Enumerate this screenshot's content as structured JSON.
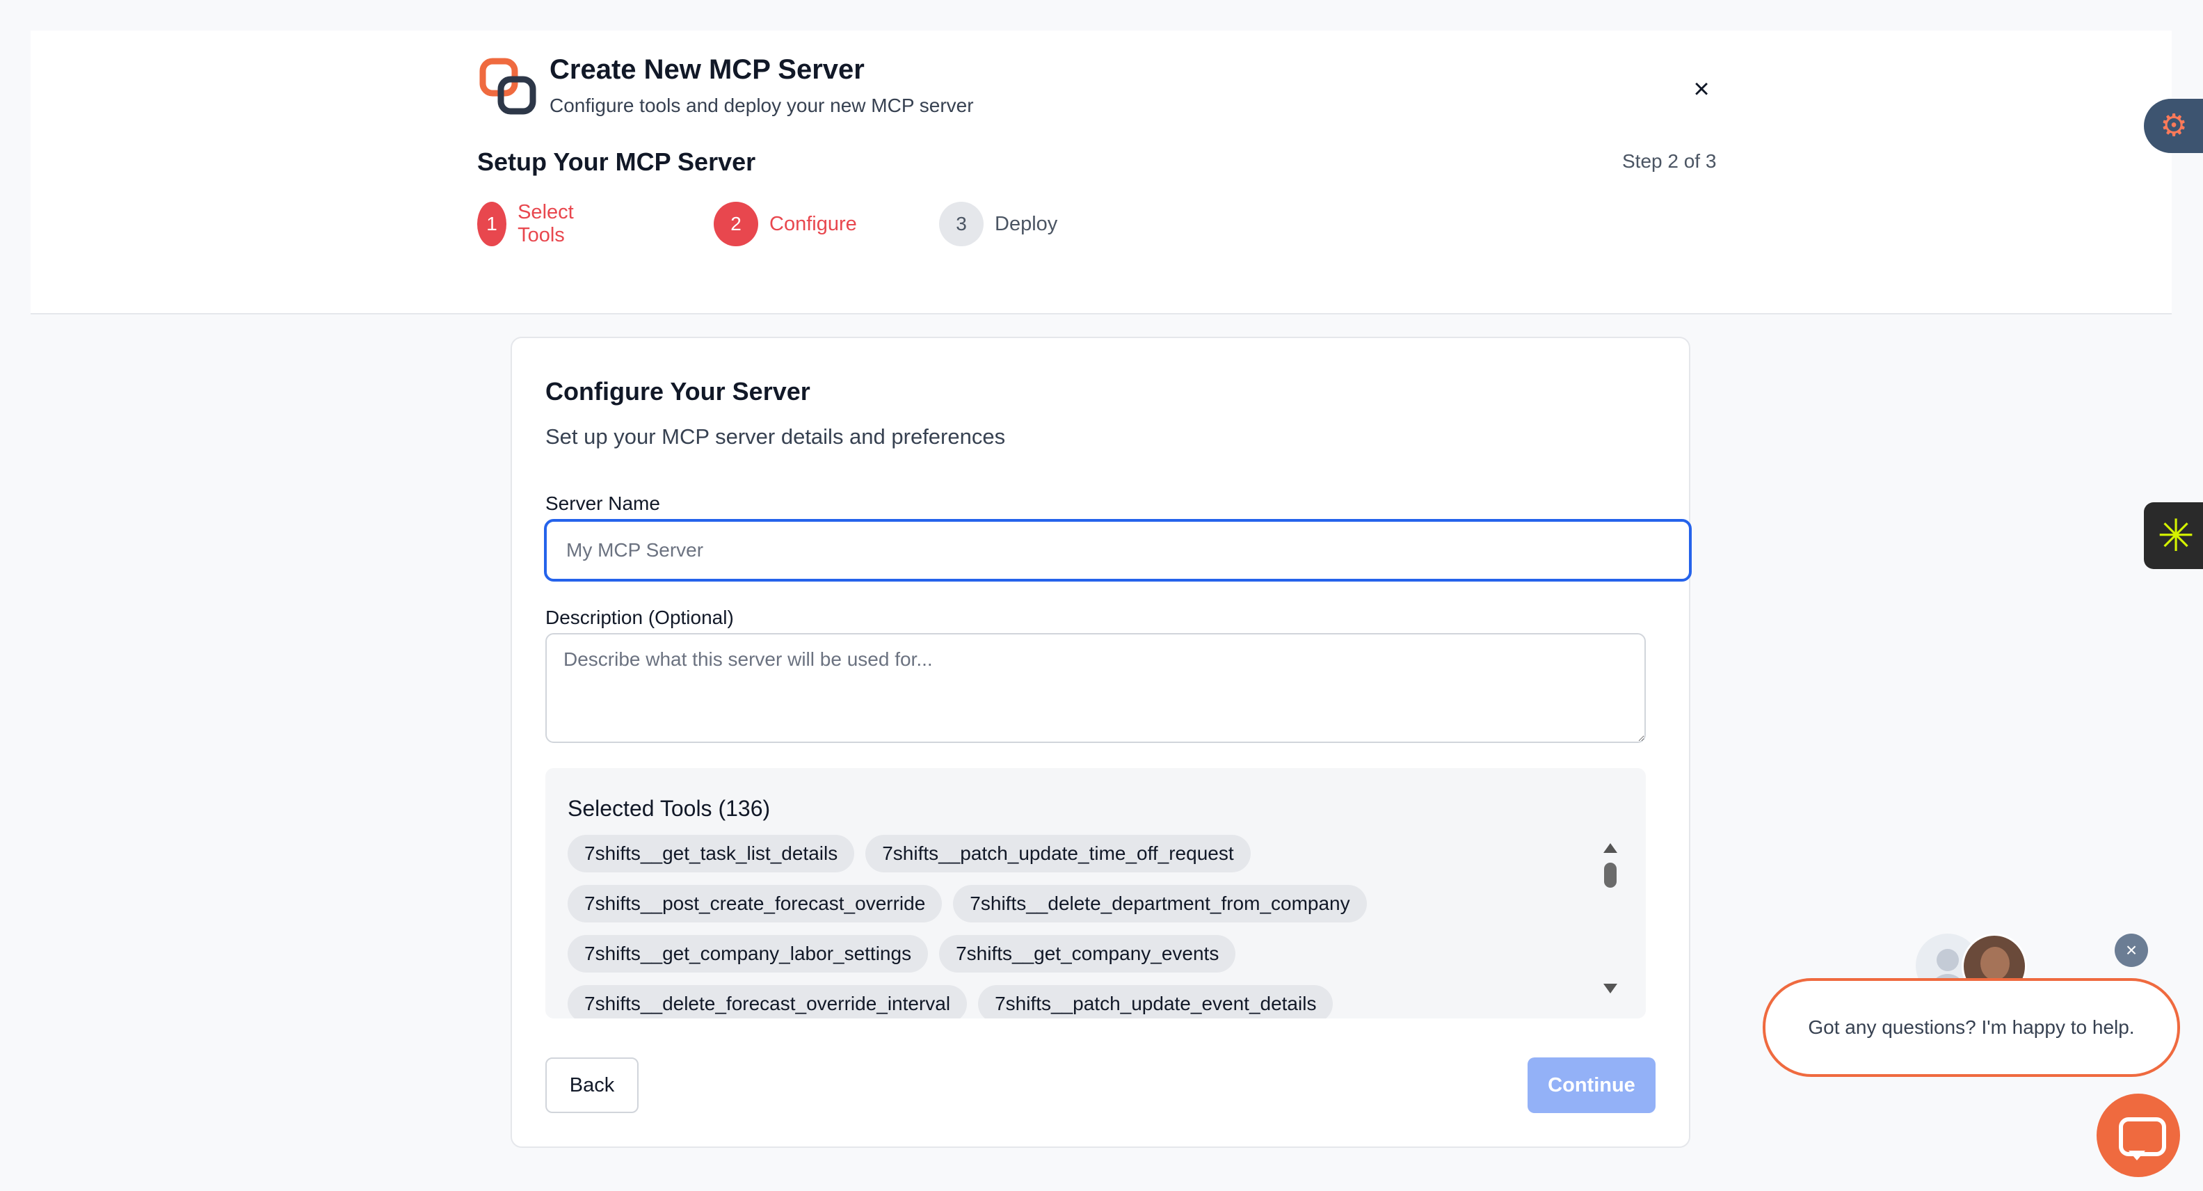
{
  "header": {
    "title": "Create New MCP Server",
    "subtitle": "Configure tools and deploy your new MCP server",
    "close_icon": "×",
    "setup_title": "Setup Your MCP Server",
    "step_count": "Step 2 of 3",
    "steps": [
      {
        "num": "1",
        "label": "Select Tools",
        "state": "active"
      },
      {
        "num": "2",
        "label": "Configure",
        "state": "active"
      },
      {
        "num": "3",
        "label": "Deploy",
        "state": "inactive"
      }
    ]
  },
  "card": {
    "title": "Configure Your Server",
    "subtitle": "Set up your MCP server details and preferences",
    "server_name_label": "Server Name",
    "server_name_placeholder": "My MCP Server",
    "server_name_value": "",
    "description_label": "Description (Optional)",
    "description_placeholder": "Describe what this server will be used for...",
    "tools_title": "Selected Tools (136)",
    "tools": [
      [
        "7shifts__get_task_list_details",
        "7shifts__patch_update_time_off_request"
      ],
      [
        "7shifts__post_create_forecast_override",
        "7shifts__delete_department_from_company"
      ],
      [
        "7shifts__get_company_labor_settings",
        "7shifts__get_company_events"
      ],
      [
        "7shifts__delete_forecast_override_interval",
        "7shifts__patch_update_event_details"
      ]
    ],
    "back_label": "Back",
    "continue_label": "Continue"
  },
  "chat": {
    "message": "Got any questions? I'm happy to help.",
    "close_icon": "×"
  },
  "icons": {
    "logo": "link-logo-icon",
    "hub": "hubspot-icon",
    "star": "asterisk-icon"
  },
  "colors": {
    "accent_red": "#e8474e",
    "focus_blue": "#2563eb",
    "continue_disabled": "#93b1f7",
    "chat_orange": "#ef6a3f"
  }
}
